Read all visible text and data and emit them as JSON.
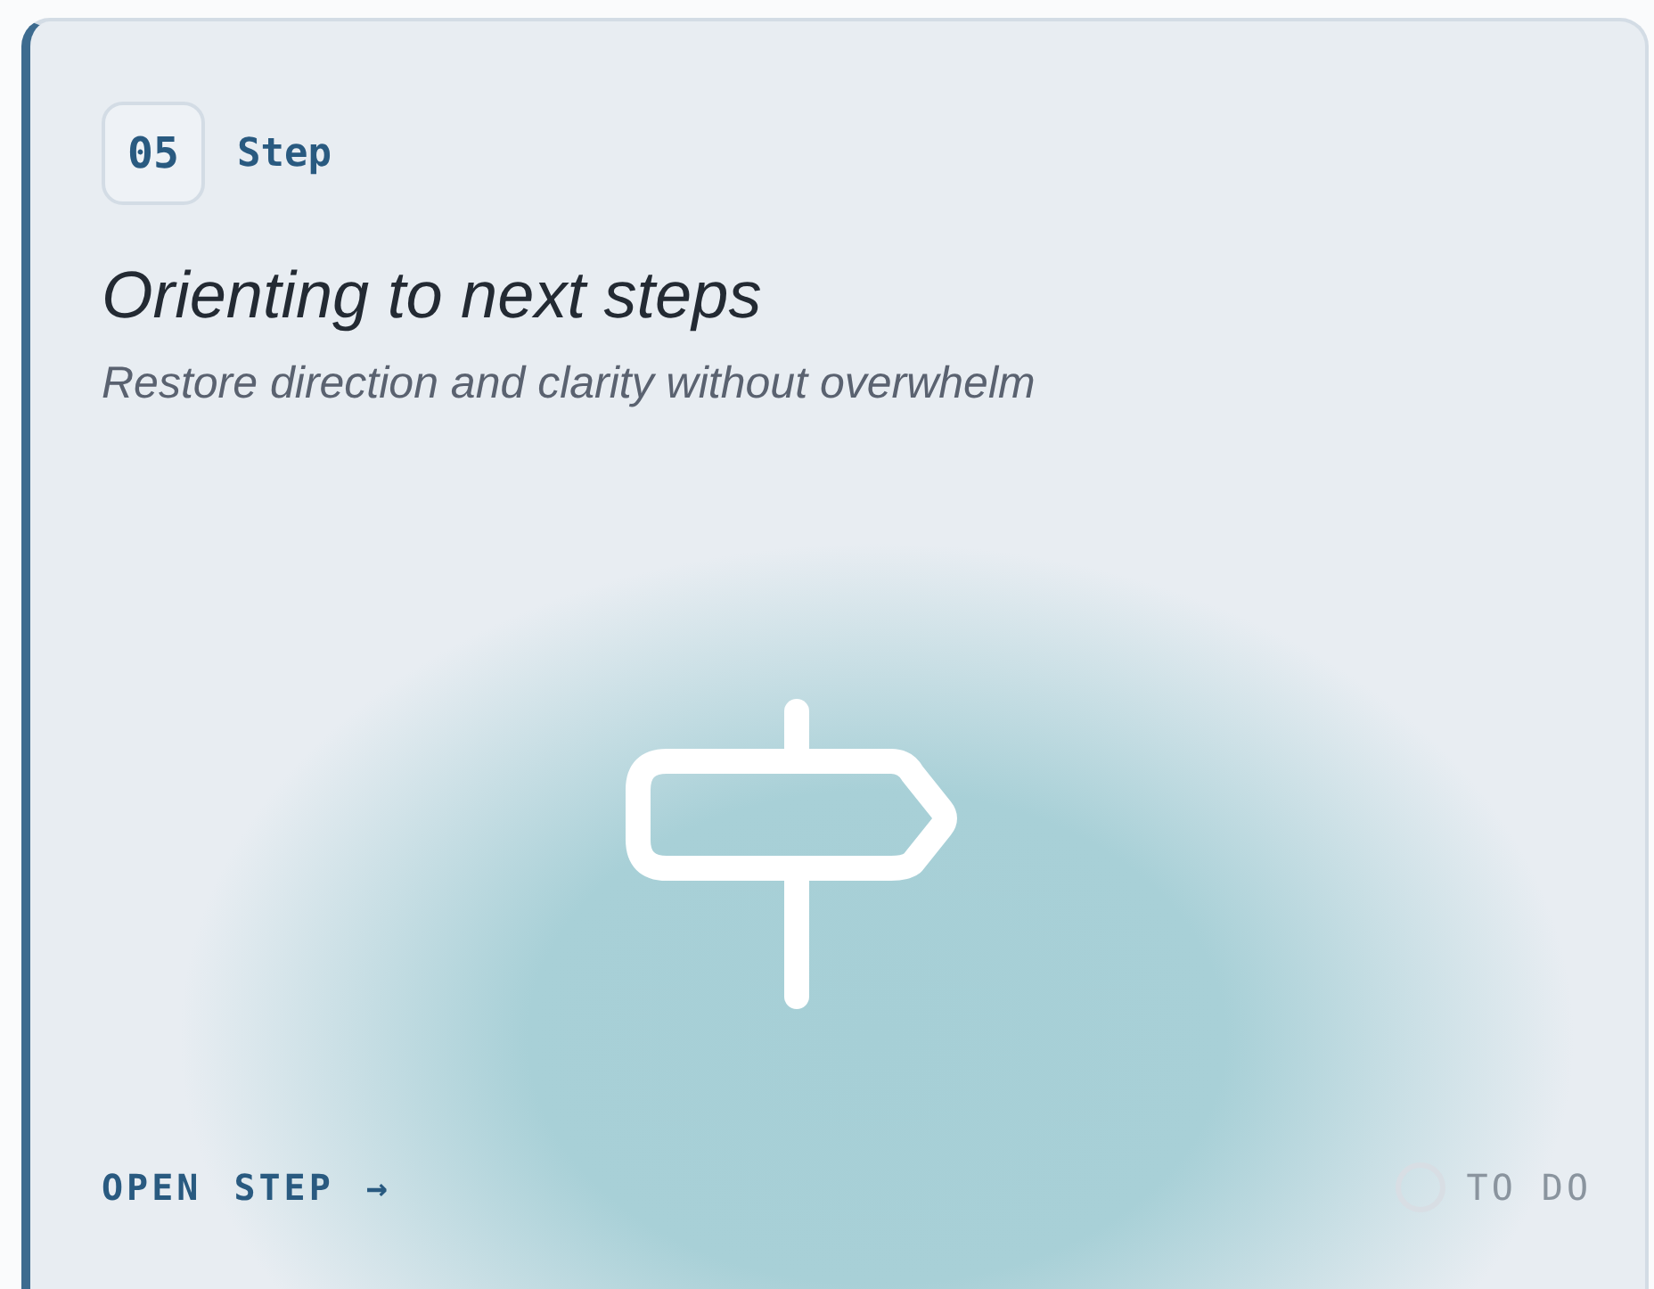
{
  "step": {
    "number": "05",
    "label": "Step"
  },
  "title": "Orienting to next steps",
  "subtitle": "Restore direction and clarity without overwhelm",
  "action": {
    "label": "OPEN STEP",
    "icon": "→"
  },
  "status": {
    "label": "TO DO",
    "done": false
  }
}
